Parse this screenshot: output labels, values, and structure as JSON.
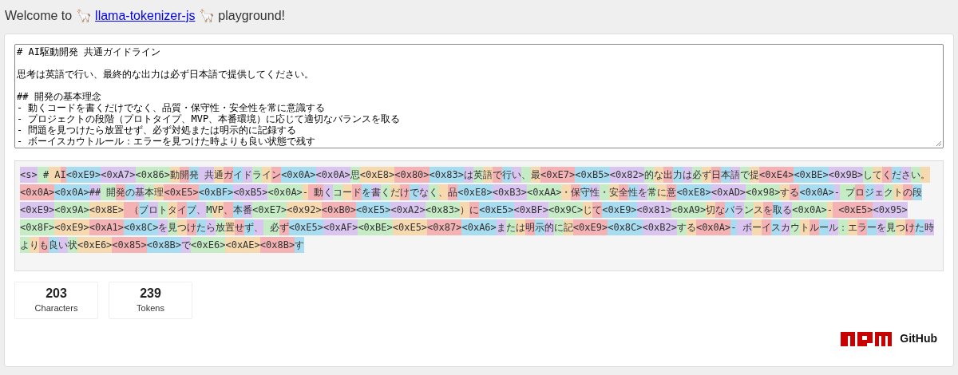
{
  "header": {
    "prefix": "Welcome to 🦙",
    "link": "llama-tokenizer-js",
    "suffix": "🦙 playground!"
  },
  "input": {
    "paragraphs": [
      [
        "# AI駆動開発 共通ガイドライン"
      ],
      [
        "思考は英語で行い、最終的な出力は必ず日本語で提供してください。"
      ],
      [
        "## 開発の基本理念",
        "- 動くコードを書くだけでなく、品質・保守性・安全性を常に意識する",
        "- プロジェクトの段階（プロトタイプ、MVP、本番環境）に応じて適切なバランスを取る",
        "- 問題を見つけたら放置せず、必ず対処または明示的に記録する",
        "- ボーイスカウトルール：エラーを見つけた時よりも良い状態で残す"
      ]
    ]
  },
  "tokens": [
    {
      "text": "<s>",
      "color": "#d9c5f0"
    },
    {
      "text": " #",
      "color": "#c5ecc5"
    },
    {
      "text": " A",
      "color": "#f7d9b0"
    },
    {
      "text": "I",
      "color": "#f4b2b5"
    },
    {
      "text": "<0xE9>",
      "color": "#a8dcf0"
    },
    {
      "text": "<0xA7>",
      "color": "#d9c5f0"
    },
    {
      "text": "<0x86>",
      "color": "#c5ecc5"
    },
    {
      "text": "動",
      "color": "#f7d9b0"
    },
    {
      "text": "開",
      "color": "#f4b2b5"
    },
    {
      "text": "発",
      "color": "#a8dcf0"
    },
    {
      "text": " 共",
      "color": "#d9c5f0"
    },
    {
      "text": "通",
      "color": "#f7d9b0"
    },
    {
      "text": "ガ",
      "color": "#f4b2b5"
    },
    {
      "text": "イ",
      "color": "#a8dcf0"
    },
    {
      "text": "ド",
      "color": "#d9c5f0"
    },
    {
      "text": "ラ",
      "color": "#c5ecc5"
    },
    {
      "text": "イ",
      "color": "#f7d9b0"
    },
    {
      "text": "ン",
      "color": "#f4b2b5"
    },
    {
      "text": "<0x0A>",
      "color": "#a8dcf0"
    },
    {
      "text": "<0x0A>",
      "color": "#d9c5f0"
    },
    {
      "text": "思",
      "color": "#c5ecc5"
    },
    {
      "text": "<0xE8>",
      "color": "#f7d9b0"
    },
    {
      "text": "<0x80>",
      "color": "#f4b2b5"
    },
    {
      "text": "<0x83>",
      "color": "#a8dcf0"
    },
    {
      "text": "は",
      "color": "#d9c5f0"
    },
    {
      "text": "英",
      "color": "#c5ecc5"
    },
    {
      "text": "語",
      "color": "#f7d9b0"
    },
    {
      "text": "で",
      "color": "#f4b2b5"
    },
    {
      "text": "行",
      "color": "#a8dcf0"
    },
    {
      "text": "い",
      "color": "#d9c5f0"
    },
    {
      "text": "、",
      "color": "#c5ecc5"
    },
    {
      "text": "最",
      "color": "#f7d9b0"
    },
    {
      "text": "<0xE7>",
      "color": "#f4b2b5"
    },
    {
      "text": "<0xB5>",
      "color": "#a8dcf0"
    },
    {
      "text": "<0x82>",
      "color": "#d9c5f0"
    },
    {
      "text": "的",
      "color": "#c5ecc5"
    },
    {
      "text": "な",
      "color": "#f7d9b0"
    },
    {
      "text": "出",
      "color": "#f4b2b5"
    },
    {
      "text": "力",
      "color": "#a8dcf0"
    },
    {
      "text": "は",
      "color": "#d9c5f0"
    },
    {
      "text": "必",
      "color": "#c5ecc5"
    },
    {
      "text": "ず",
      "color": "#f7d9b0"
    },
    {
      "text": "日",
      "color": "#f4b2b5"
    },
    {
      "text": "本",
      "color": "#a8dcf0"
    },
    {
      "text": "語",
      "color": "#d9c5f0"
    },
    {
      "text": "で",
      "color": "#c5ecc5"
    },
    {
      "text": "提",
      "color": "#f7d9b0"
    },
    {
      "text": "<0xE4>",
      "color": "#f4b2b5"
    },
    {
      "text": "<0xBE>",
      "color": "#a8dcf0"
    },
    {
      "text": "<0x9B>",
      "color": "#d9c5f0"
    },
    {
      "text": "し",
      "color": "#c5ecc5"
    },
    {
      "text": "て",
      "color": "#f7d9b0"
    },
    {
      "text": "く",
      "color": "#f4b2b5"
    },
    {
      "text": "だ",
      "color": "#a8dcf0"
    },
    {
      "text": "さ",
      "color": "#d9c5f0"
    },
    {
      "text": "い",
      "color": "#c5ecc5"
    },
    {
      "text": "。",
      "color": "#f7d9b0"
    },
    {
      "text": "<0x0A>",
      "color": "#f4b2b5"
    },
    {
      "text": "<0x0A>",
      "color": "#a8dcf0"
    },
    {
      "text": "##",
      "color": "#d9c5f0"
    },
    {
      "text": " 開",
      "color": "#c5ecc5"
    },
    {
      "text": "発",
      "color": "#f4b2b5"
    },
    {
      "text": "の",
      "color": "#a8dcf0"
    },
    {
      "text": "基",
      "color": "#d9c5f0"
    },
    {
      "text": "本",
      "color": "#c5ecc5"
    },
    {
      "text": "理",
      "color": "#f7d9b0"
    },
    {
      "text": "<0xE5>",
      "color": "#f4b2b5"
    },
    {
      "text": "<0xBF>",
      "color": "#a8dcf0"
    },
    {
      "text": "<0xB5>",
      "color": "#d9c5f0"
    },
    {
      "text": "<0x0A>",
      "color": "#c5ecc5"
    },
    {
      "text": "-",
      "color": "#f7d9b0"
    },
    {
      "text": " 動",
      "color": "#f4b2b5"
    },
    {
      "text": "く",
      "color": "#d9c5f0"
    },
    {
      "text": "コ",
      "color": "#c5ecc5"
    },
    {
      "text": "ー",
      "color": "#f7d9b0"
    },
    {
      "text": "ド",
      "color": "#f4b2b5"
    },
    {
      "text": "を",
      "color": "#a8dcf0"
    },
    {
      "text": "書",
      "color": "#d9c5f0"
    },
    {
      "text": "く",
      "color": "#c5ecc5"
    },
    {
      "text": "だ",
      "color": "#f7d9b0"
    },
    {
      "text": "け",
      "color": "#f4b2b5"
    },
    {
      "text": "で",
      "color": "#a8dcf0"
    },
    {
      "text": "な",
      "color": "#d9c5f0"
    },
    {
      "text": "く",
      "color": "#c5ecc5"
    },
    {
      "text": "、",
      "color": "#f7d9b0"
    },
    {
      "text": "品",
      "color": "#f4b2b5"
    },
    {
      "text": "<0xE8>",
      "color": "#a8dcf0"
    },
    {
      "text": "<0xB3>",
      "color": "#d9c5f0"
    },
    {
      "text": "<0xAA>",
      "color": "#c5ecc5"
    },
    {
      "text": "・",
      "color": "#f7d9b0"
    },
    {
      "text": "保",
      "color": "#f4b2b5"
    },
    {
      "text": "守",
      "color": "#a8dcf0"
    },
    {
      "text": "性",
      "color": "#d9c5f0"
    },
    {
      "text": "・",
      "color": "#c5ecc5"
    },
    {
      "text": "安",
      "color": "#f7d9b0"
    },
    {
      "text": "全",
      "color": "#f4b2b5"
    },
    {
      "text": "性",
      "color": "#a8dcf0"
    },
    {
      "text": "を",
      "color": "#d9c5f0"
    },
    {
      "text": "常",
      "color": "#c5ecc5"
    },
    {
      "text": "に",
      "color": "#f7d9b0"
    },
    {
      "text": "意",
      "color": "#f4b2b5"
    },
    {
      "text": "<0xE8>",
      "color": "#a8dcf0"
    },
    {
      "text": "<0xAD>",
      "color": "#d9c5f0"
    },
    {
      "text": "<0x98>",
      "color": "#c5ecc5"
    },
    {
      "text": "す",
      "color": "#f7d9b0"
    },
    {
      "text": "る",
      "color": "#f4b2b5"
    },
    {
      "text": "<0x0A>",
      "color": "#a8dcf0"
    },
    {
      "text": "-",
      "color": "#d9c5f0"
    },
    {
      "text": " プ",
      "color": "#c5ecc5"
    },
    {
      "text": "ロ",
      "color": "#f4b2b5"
    },
    {
      "text": "ジ",
      "color": "#a8dcf0"
    },
    {
      "text": "ェ",
      "color": "#d9c5f0"
    },
    {
      "text": "ク",
      "color": "#c5ecc5"
    },
    {
      "text": "ト",
      "color": "#f7d9b0"
    },
    {
      "text": "の",
      "color": "#f4b2b5"
    },
    {
      "text": "段",
      "color": "#a8dcf0"
    },
    {
      "text": "<0xE9>",
      "color": "#d9c5f0"
    },
    {
      "text": "<0x9A>",
      "color": "#c5ecc5"
    },
    {
      "text": "<0x8E>",
      "color": "#f7d9b0"
    },
    {
      "text": " （",
      "color": "#f4b2b5"
    },
    {
      "text": "プ",
      "color": "#a8dcf0"
    },
    {
      "text": "ロ",
      "color": "#d9c5f0"
    },
    {
      "text": "ト",
      "color": "#c5ecc5"
    },
    {
      "text": "タ",
      "color": "#f7d9b0"
    },
    {
      "text": "イ",
      "color": "#f4b2b5"
    },
    {
      "text": "プ",
      "color": "#a8dcf0"
    },
    {
      "text": "、",
      "color": "#d9c5f0"
    },
    {
      "text": "M",
      "color": "#c5ecc5"
    },
    {
      "text": "VP",
      "color": "#f7d9b0"
    },
    {
      "text": "、",
      "color": "#f4b2b5"
    },
    {
      "text": "本",
      "color": "#a8dcf0"
    },
    {
      "text": "番",
      "color": "#d9c5f0"
    },
    {
      "text": "<0xE7>",
      "color": "#c5ecc5"
    },
    {
      "text": "<0x92>",
      "color": "#f7d9b0"
    },
    {
      "text": "<0xB0>",
      "color": "#f4b2b5"
    },
    {
      "text": "<0xE5>",
      "color": "#a8dcf0"
    },
    {
      "text": "<0xA2>",
      "color": "#d9c5f0"
    },
    {
      "text": "<0x83>",
      "color": "#c5ecc5"
    },
    {
      "text": "）",
      "color": "#f7d9b0"
    },
    {
      "text": "に",
      "color": "#f4b2b5"
    },
    {
      "text": "<0xE5>",
      "color": "#a8dcf0"
    },
    {
      "text": "<0xBF>",
      "color": "#d9c5f0"
    },
    {
      "text": "<0x9C>",
      "color": "#c5ecc5"
    },
    {
      "text": "じ",
      "color": "#f7d9b0"
    },
    {
      "text": "て",
      "color": "#f4b2b5"
    },
    {
      "text": "<0xE9>",
      "color": "#a8dcf0"
    },
    {
      "text": "<0x81>",
      "color": "#d9c5f0"
    },
    {
      "text": "<0xA9>",
      "color": "#c5ecc5"
    },
    {
      "text": "切",
      "color": "#f7d9b0"
    },
    {
      "text": "な",
      "color": "#f4b2b5"
    },
    {
      "text": "バ",
      "color": "#a8dcf0"
    },
    {
      "text": "ラ",
      "color": "#d9c5f0"
    },
    {
      "text": "ン",
      "color": "#c5ecc5"
    },
    {
      "text": "ス",
      "color": "#f7d9b0"
    },
    {
      "text": "を",
      "color": "#f4b2b5"
    },
    {
      "text": "取",
      "color": "#a8dcf0"
    },
    {
      "text": "る",
      "color": "#d9c5f0"
    },
    {
      "text": "<0x0A>",
      "color": "#c5ecc5"
    },
    {
      "text": "-",
      "color": "#f7d9b0"
    },
    {
      "text": " <0xE5>",
      "color": "#f4b2b5"
    },
    {
      "text": "<0x95>",
      "color": "#d9c5f0"
    },
    {
      "text": "<0x8F>",
      "color": "#c5ecc5"
    },
    {
      "text": "<0xE9>",
      "color": "#f7d9b0"
    },
    {
      "text": "<0xA1>",
      "color": "#f4b2b5"
    },
    {
      "text": "<0x8C>",
      "color": "#a8dcf0"
    },
    {
      "text": "を",
      "color": "#d9c5f0"
    },
    {
      "text": "見",
      "color": "#c5ecc5"
    },
    {
      "text": "つ",
      "color": "#f7d9b0"
    },
    {
      "text": "け",
      "color": "#f4b2b5"
    },
    {
      "text": "た",
      "color": "#a8dcf0"
    },
    {
      "text": "ら",
      "color": "#d9c5f0"
    },
    {
      "text": "放",
      "color": "#c5ecc5"
    },
    {
      "text": "置",
      "color": "#f7d9b0"
    },
    {
      "text": "せ",
      "color": "#f4b2b5"
    },
    {
      "text": "ず",
      "color": "#a8dcf0"
    },
    {
      "text": "、",
      "color": "#d9c5f0"
    },
    {
      "text": " 必",
      "color": "#c5ecc5"
    },
    {
      "text": "ず",
      "color": "#f4b2b5"
    },
    {
      "text": "<0xE5>",
      "color": "#a8dcf0"
    },
    {
      "text": "<0xAF>",
      "color": "#d9c5f0"
    },
    {
      "text": "<0xBE>",
      "color": "#c5ecc5"
    },
    {
      "text": "<0xE5>",
      "color": "#f7d9b0"
    },
    {
      "text": "<0x87>",
      "color": "#f4b2b5"
    },
    {
      "text": "<0xA6>",
      "color": "#a8dcf0"
    },
    {
      "text": "ま",
      "color": "#d9c5f0"
    },
    {
      "text": "た",
      "color": "#c5ecc5"
    },
    {
      "text": "は",
      "color": "#f7d9b0"
    },
    {
      "text": "明",
      "color": "#f4b2b5"
    },
    {
      "text": "示",
      "color": "#a8dcf0"
    },
    {
      "text": "的",
      "color": "#d9c5f0"
    },
    {
      "text": "に",
      "color": "#c5ecc5"
    },
    {
      "text": "記",
      "color": "#f7d9b0"
    },
    {
      "text": "<0xE9>",
      "color": "#f4b2b5"
    },
    {
      "text": "<0x8C>",
      "color": "#a8dcf0"
    },
    {
      "text": "<0xB2>",
      "color": "#d9c5f0"
    },
    {
      "text": "す",
      "color": "#c5ecc5"
    },
    {
      "text": "る",
      "color": "#f7d9b0"
    },
    {
      "text": "<0x0A>",
      "color": "#f4b2b5"
    },
    {
      "text": "-",
      "color": "#a8dcf0"
    },
    {
      "text": " ボ",
      "color": "#d9c5f0"
    },
    {
      "text": "ー",
      "color": "#f7d9b0"
    },
    {
      "text": "イ",
      "color": "#f4b2b5"
    },
    {
      "text": "ス",
      "color": "#a8dcf0"
    },
    {
      "text": "カ",
      "color": "#d9c5f0"
    },
    {
      "text": "ウ",
      "color": "#c5ecc5"
    },
    {
      "text": "ト",
      "color": "#f7d9b0"
    },
    {
      "text": "ル",
      "color": "#f4b2b5"
    },
    {
      "text": "ー",
      "color": "#a8dcf0"
    },
    {
      "text": "ル",
      "color": "#d9c5f0"
    },
    {
      "text": "：",
      "color": "#c5ecc5"
    },
    {
      "text": "エ",
      "color": "#f7d9b0"
    },
    {
      "text": "ラ",
      "color": "#f4b2b5"
    },
    {
      "text": "ー",
      "color": "#a8dcf0"
    },
    {
      "text": "を",
      "color": "#d9c5f0"
    },
    {
      "text": "見",
      "color": "#c5ecc5"
    },
    {
      "text": "つ",
      "color": "#f7d9b0"
    },
    {
      "text": "け",
      "color": "#f4b2b5"
    },
    {
      "text": "た",
      "color": "#a8dcf0"
    },
    {
      "text": "時",
      "color": "#d9c5f0"
    },
    {
      "text": "よ",
      "color": "#c5ecc5"
    },
    {
      "text": "り",
      "color": "#f7d9b0"
    },
    {
      "text": "も",
      "color": "#f4b2b5"
    },
    {
      "text": "良",
      "color": "#a8dcf0"
    },
    {
      "text": "い",
      "color": "#d9c5f0"
    },
    {
      "text": "状",
      "color": "#c5ecc5"
    },
    {
      "text": "<0xE6>",
      "color": "#f7d9b0"
    },
    {
      "text": "<0x85>",
      "color": "#f4b2b5"
    },
    {
      "text": "<0x8B>",
      "color": "#a8dcf0"
    },
    {
      "text": "で",
      "color": "#d9c5f0"
    },
    {
      "text": "<0xE6>",
      "color": "#c5ecc5"
    },
    {
      "text": "<0xAE>",
      "color": "#f7d9b0"
    },
    {
      "text": "<0x8B>",
      "color": "#f4b2b5"
    },
    {
      "text": "す",
      "color": "#a8dcf0"
    }
  ],
  "stats": [
    {
      "value": "203",
      "label": "Characters"
    },
    {
      "value": "239",
      "label": "Tokens"
    }
  ],
  "footer": {
    "github": "GitHub"
  }
}
